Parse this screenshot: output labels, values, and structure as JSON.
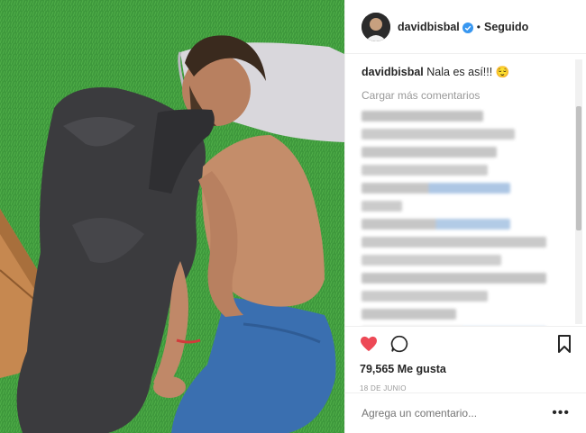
{
  "post": {
    "username": "davidbisbal",
    "follow_status": "Seguido",
    "separator": "•",
    "caption_user": "davidbisbal",
    "caption_text": "Nala es así!!! 😌",
    "load_more": "Cargar más comentarios",
    "likes": "79,565 Me gusta",
    "date": "18 DE JUNIO",
    "comment_placeholder": "Agrega un comentario...",
    "more_options": "•••"
  },
  "colors": {
    "like_red": "#ed4956",
    "verified_blue": "#3897f0",
    "grass": "#3f9a3f",
    "text": "#262626",
    "muted": "#999999"
  },
  "icons": [
    "verified-icon",
    "heart-icon",
    "comment-icon",
    "bookmark-icon",
    "more-options-icon"
  ]
}
